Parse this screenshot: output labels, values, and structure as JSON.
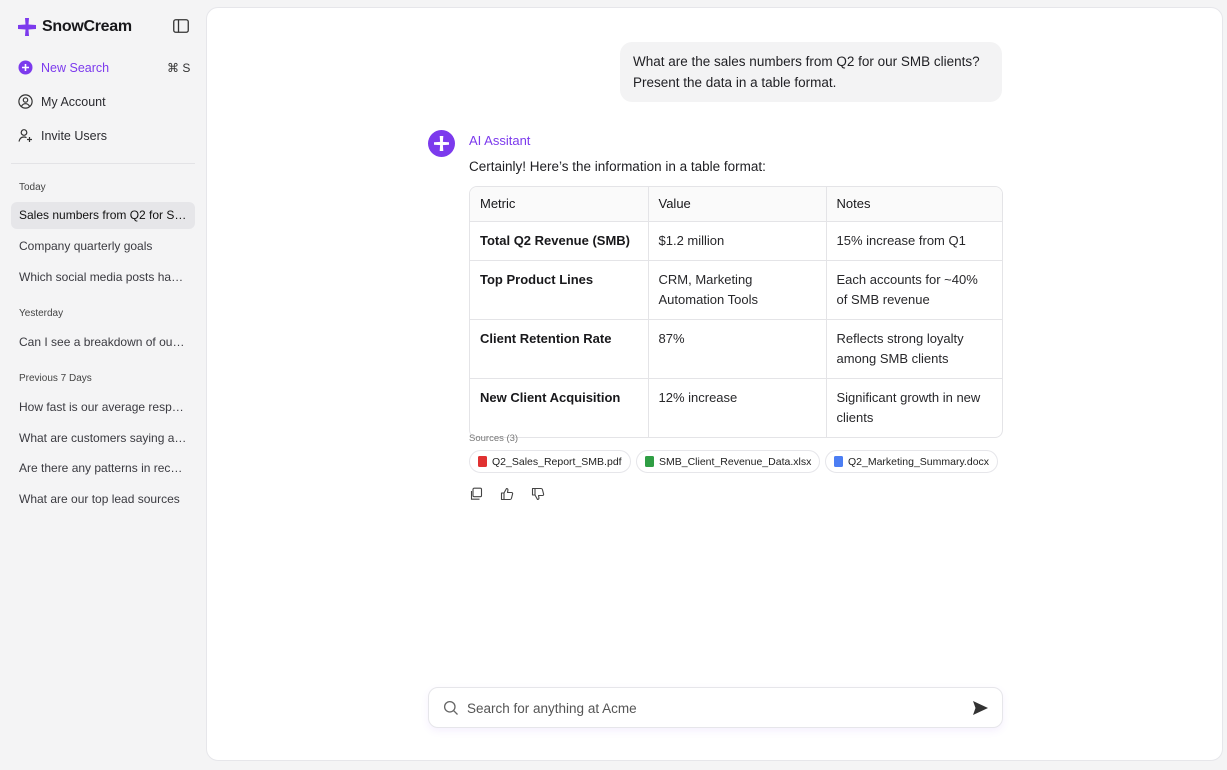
{
  "brand": {
    "name": "SnowCream",
    "color": "#7c3aed"
  },
  "nav": {
    "new_search": "New Search",
    "new_search_shortcut": "⌘ S",
    "my_account": "My Account",
    "invite_users": "Invite Users"
  },
  "history": {
    "groups": [
      {
        "title": "Today",
        "items": [
          "Sales numbers from Q2 for SMB clients",
          "Company quarterly goals",
          "Which social media posts have performed best"
        ]
      },
      {
        "title": "Yesterday",
        "items": [
          "Can I see a breakdown of our revenue"
        ]
      },
      {
        "title": "Previous 7 Days",
        "items": [
          "How fast is our average response time",
          "What are customers saying about us",
          "Are there any patterns in recent churn",
          "What are our top lead sources"
        ]
      }
    ]
  },
  "chat": {
    "user_message": "What are the sales numbers from Q2 for our SMB clients? Present the data in a table format.",
    "assistant_name": "AI Assitant",
    "assistant_intro": "Certainly! Here’s the information in a table format:",
    "table": {
      "headers": [
        "Metric",
        "Value",
        "Notes"
      ],
      "rows": [
        [
          "Total Q2 Revenue (SMB)",
          "$1.2 million",
          "15% increase from Q1"
        ],
        [
          "Top Product Lines",
          "CRM, Marketing Automation Tools",
          "Each accounts for ~40% of SMB revenue"
        ],
        [
          "Client Retention Rate",
          "87%",
          "Reflects strong loyalty among SMB clients"
        ],
        [
          "New Client Acquisition",
          "12% increase",
          "Significant growth in new clients"
        ]
      ]
    },
    "sources_label": "Sources (3)",
    "sources": [
      {
        "name": "Q2_Sales_Report_SMB.pdf",
        "color": "#e03131"
      },
      {
        "name": "SMB_Client_Revenue_Data.xlsx",
        "color": "#2f9e44"
      },
      {
        "name": "Q2_Marketing_Summary.docx",
        "color": "#4c7ef3"
      }
    ]
  },
  "search": {
    "placeholder": "Search for anything at Acme"
  }
}
